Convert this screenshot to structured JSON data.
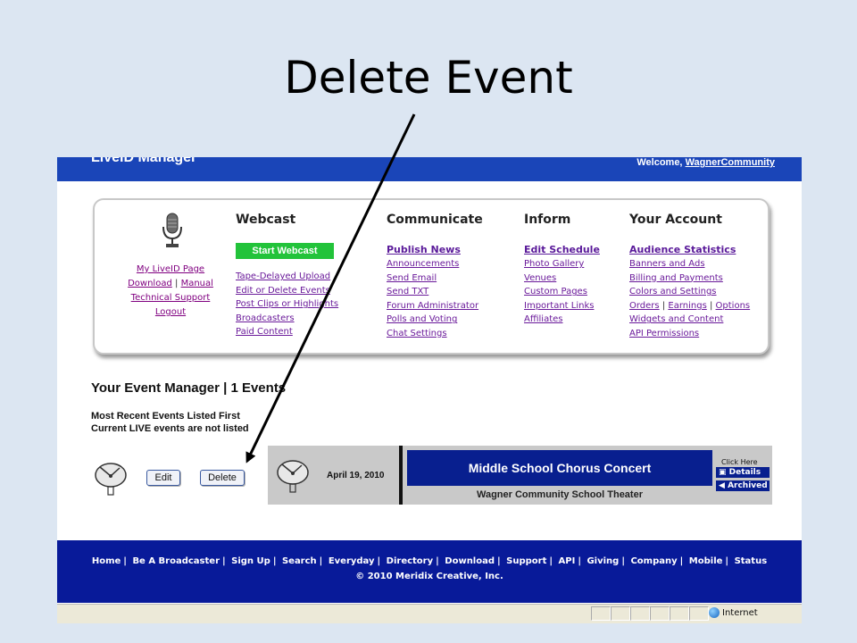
{
  "slide": {
    "title": "Delete Event"
  },
  "header": {
    "brand": "LiveID Manager",
    "welcome_prefix": "Welcome, ",
    "username": "WagnerCommunity"
  },
  "left": {
    "my_page": "My LiveID Page",
    "download": "Download",
    "manual": "Manual",
    "support": "Technical Support",
    "logout": "Logout"
  },
  "webcast": {
    "heading": "Webcast",
    "start_button": "Start Webcast",
    "links": [
      "Tape-Delayed Upload",
      "Edit or Delete Events",
      "Post Clips or Highlights",
      "Broadcasters",
      "Paid Content"
    ]
  },
  "communicate": {
    "heading": "Communicate",
    "lead": "Publish News",
    "links": [
      "Announcements",
      "Send Email",
      "Send TXT",
      "Forum Administrator",
      "Polls and Voting",
      "Chat Settings"
    ]
  },
  "inform": {
    "heading": "Inform",
    "lead": "Edit Schedule",
    "links": [
      "Photo Gallery",
      "Venues",
      "Custom Pages",
      "Important Links",
      "Affiliates"
    ]
  },
  "account": {
    "heading": "Your Account",
    "lead": "Audience Statistics",
    "links": [
      "Banners and Ads",
      "Billing and Payments",
      "Colors and Settings"
    ],
    "orders": "Orders",
    "earnings": "Earnings",
    "options": "Options",
    "links2": [
      "Widgets and Content",
      "API Permissions"
    ]
  },
  "event_manager": {
    "title": "Your Event Manager | 1 Events",
    "note1": "Most Recent Events Listed First",
    "note2": "Current LIVE events are not listed",
    "edit": "Edit",
    "delete": "Delete"
  },
  "event": {
    "date": "April 19, 2010",
    "title": "Middle School Chorus Concert",
    "venue": "Wagner Community School Theater",
    "click_here": "Click Here",
    "details": "Details",
    "archived": "Archived"
  },
  "footer": {
    "links": [
      "Home",
      "Be A Broadcaster",
      "Sign Up",
      "Search",
      "Everyday",
      "Directory",
      "Download",
      "Support",
      "API",
      "Giving",
      "Company",
      "Mobile",
      "Status"
    ],
    "copyright": "© 2010 Meridix Creative, Inc."
  },
  "status": {
    "zone": "Internet"
  },
  "colors": {
    "header_blue": "#1a45b8",
    "footer_blue": "#081a99",
    "start_green": "#22c33a",
    "link_purple": "#6a1a9a"
  }
}
